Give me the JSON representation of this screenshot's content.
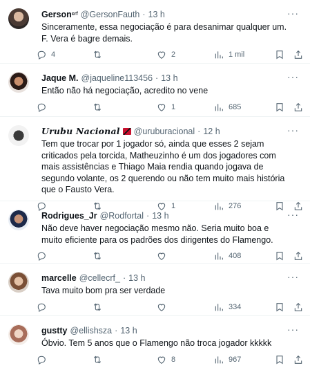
{
  "tweets": [
    {
      "name": "Gerson",
      "name_suffix": "crf",
      "handle": "@GersonFauth",
      "time": "13 h",
      "text": "Sinceramente, essa negociação é para desanimar qualquer um. F. Vera é bagre demais.",
      "replies": "4",
      "retweets": "",
      "likes": "2",
      "views": "1 mil"
    },
    {
      "name": "Jaque M.",
      "handle": "@jaqueline113456",
      "time": "13 h",
      "text": "Então não há negociação, acredito no vene",
      "replies": "",
      "retweets": "",
      "likes": "1",
      "views": "685"
    },
    {
      "name": "Urubu Nacional",
      "handle": "@uruburacional",
      "time": "12 h",
      "text": "Tem que trocar por 1 jogador só, ainda que esses 2 sejam criticados pela torcida, Matheuzinho é um dos jogadores com mais assistências e Thiago Maia rendia quando jogava de segundo volante, os 2 querendo ou não tem muito mais história que o Fausto Vera.",
      "replies": "",
      "retweets": "",
      "likes": "1",
      "views": "276"
    },
    {
      "name": "Rodrigues_Jr",
      "handle": "@Rodfortal",
      "time": "13 h",
      "text": "Não deve haver negociação mesmo não. Seria muito boa e muito eficiente para os padrões dos dirigentes do Flamengo.",
      "replies": "",
      "retweets": "",
      "likes": "",
      "views": "408"
    },
    {
      "name": "marcelle",
      "handle": "@cellecrf_",
      "time": "13 h",
      "text": "Tava muito bom pra ser verdade",
      "replies": "",
      "retweets": "",
      "likes": "",
      "views": "334"
    },
    {
      "name": "gustty",
      "handle": "@ellishsza",
      "time": "13 h",
      "text": "Óbvio. Tem 5 anos que o Flamengo não troca jogador kkkkk",
      "replies": "",
      "retweets": "",
      "likes": "8",
      "views": "967"
    }
  ],
  "ui": {
    "dot": "·",
    "more": "···"
  },
  "icons": [
    "reply-icon",
    "retweet-icon",
    "like-icon",
    "views-icon",
    "bookmark-icon",
    "share-icon",
    "more-icon"
  ]
}
